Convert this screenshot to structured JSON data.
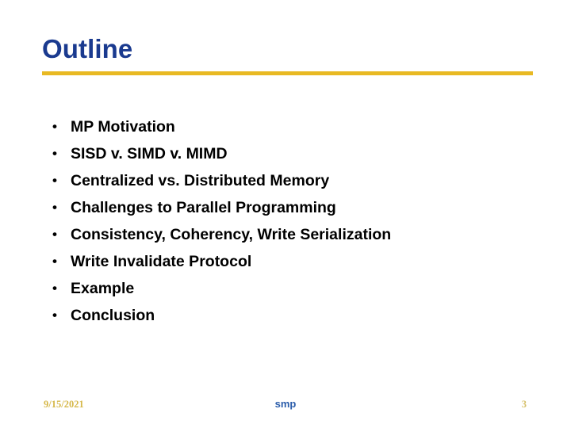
{
  "slide": {
    "title": "Outline",
    "background_color": "#ffffff",
    "title_color": "#1a3a8f",
    "accent_color": "#e8b923",
    "bullet_marker": "•",
    "bullets": [
      {
        "text": "MP Motivation"
      },
      {
        "text": "SISD v. SIMD v. MIMD"
      },
      {
        "text": "Centralized vs. Distributed Memory"
      },
      {
        "text": "Challenges to Parallel Programming"
      },
      {
        "text": "Consistency, Coherency, Write Serialization"
      },
      {
        "text": "Write Invalidate Protocol"
      },
      {
        "text": "Example"
      },
      {
        "text": "Conclusion"
      }
    ]
  },
  "footer": {
    "date": "9/15/2021",
    "date_color": "#d6b84a",
    "center_label": "smp",
    "center_color": "#2a5caa",
    "page_number": "3",
    "page_number_color": "#d6c06a"
  }
}
